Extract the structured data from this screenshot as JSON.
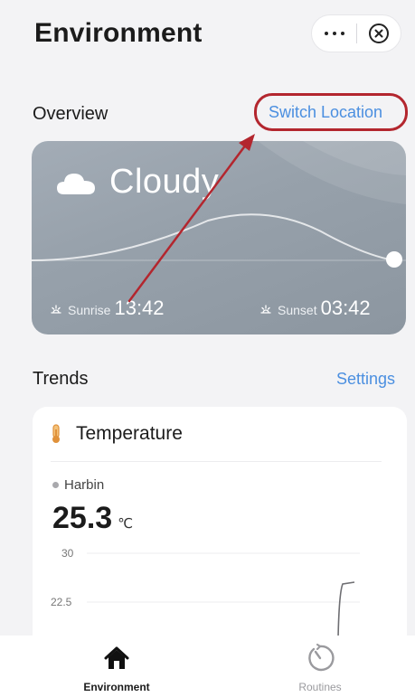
{
  "header": {
    "title": "Environment"
  },
  "overview": {
    "label": "Overview",
    "switch_location": "Switch Location"
  },
  "weather": {
    "condition": "Cloudy",
    "sunrise_label": "Sunrise",
    "sunrise_time": "13:42",
    "sunset_label": "Sunset",
    "sunset_time": "03:42"
  },
  "trends": {
    "label": "Trends",
    "settings": "Settings",
    "card": {
      "title": "Temperature",
      "location": "Harbin",
      "value": "25.3",
      "unit": "℃"
    },
    "chart": {
      "y_ticks": [
        "30",
        "22.5"
      ]
    }
  },
  "nav": {
    "environment": "Environment",
    "routines": "Routines"
  },
  "colors": {
    "accent_link": "#4b8fe0",
    "annotation_red": "#b3262e"
  }
}
